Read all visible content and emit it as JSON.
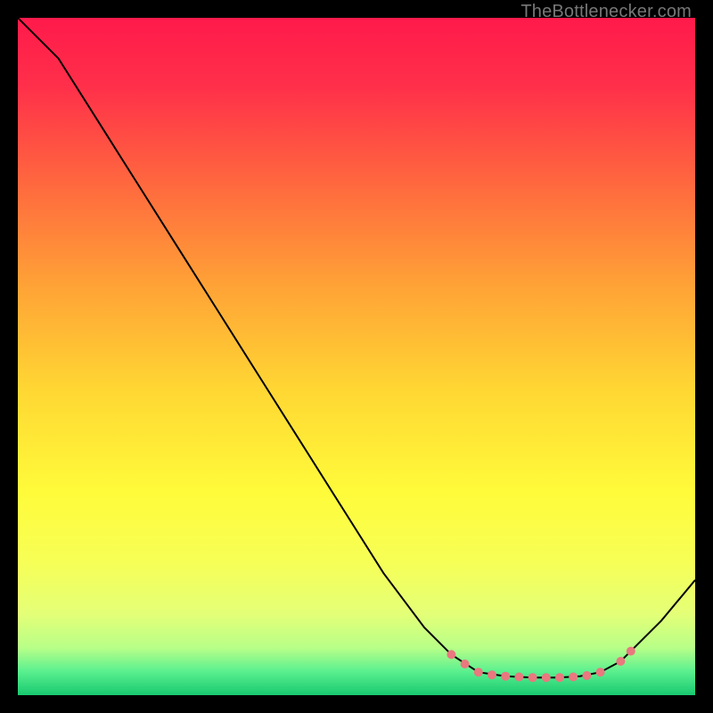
{
  "attribution": "TheBottlenecker.com",
  "chart_data": {
    "type": "line",
    "title": "",
    "xlabel": "",
    "ylabel": "",
    "xlim": [
      0,
      100
    ],
    "ylim": [
      0,
      100
    ],
    "series": [
      {
        "name": "curve",
        "x": [
          0,
          6,
          12,
          18,
          24,
          30,
          36,
          42,
          48,
          54,
          60,
          64,
          68,
          72,
          76,
          80,
          83,
          86,
          89,
          92,
          95,
          100
        ],
        "y": [
          100,
          94,
          84.5,
          75,
          65.5,
          56,
          46.5,
          37,
          27.5,
          18,
          10,
          6,
          3.4,
          2.8,
          2.6,
          2.6,
          2.8,
          3.4,
          5,
          8,
          11,
          17
        ]
      }
    ],
    "markers": {
      "x": [
        64,
        66,
        68,
        70,
        72,
        74,
        76,
        78,
        80,
        82,
        84,
        86,
        89,
        90.5
      ],
      "y": [
        6,
        4.6,
        3.4,
        3.0,
        2.8,
        2.7,
        2.6,
        2.6,
        2.6,
        2.7,
        2.9,
        3.4,
        5,
        6.5
      ],
      "color": "#e9787f",
      "radius": 5
    },
    "gradient_stops": [
      {
        "offset": 0.0,
        "color": "#ff1a4b"
      },
      {
        "offset": 0.1,
        "color": "#ff2f4a"
      },
      {
        "offset": 0.25,
        "color": "#ff6a3e"
      },
      {
        "offset": 0.4,
        "color": "#ffa436"
      },
      {
        "offset": 0.55,
        "color": "#ffd733"
      },
      {
        "offset": 0.7,
        "color": "#fffb3a"
      },
      {
        "offset": 0.8,
        "color": "#f7ff55"
      },
      {
        "offset": 0.88,
        "color": "#e4ff77"
      },
      {
        "offset": 0.93,
        "color": "#b8ff88"
      },
      {
        "offset": 0.965,
        "color": "#5af08f"
      },
      {
        "offset": 1.0,
        "color": "#18c96f"
      }
    ]
  }
}
